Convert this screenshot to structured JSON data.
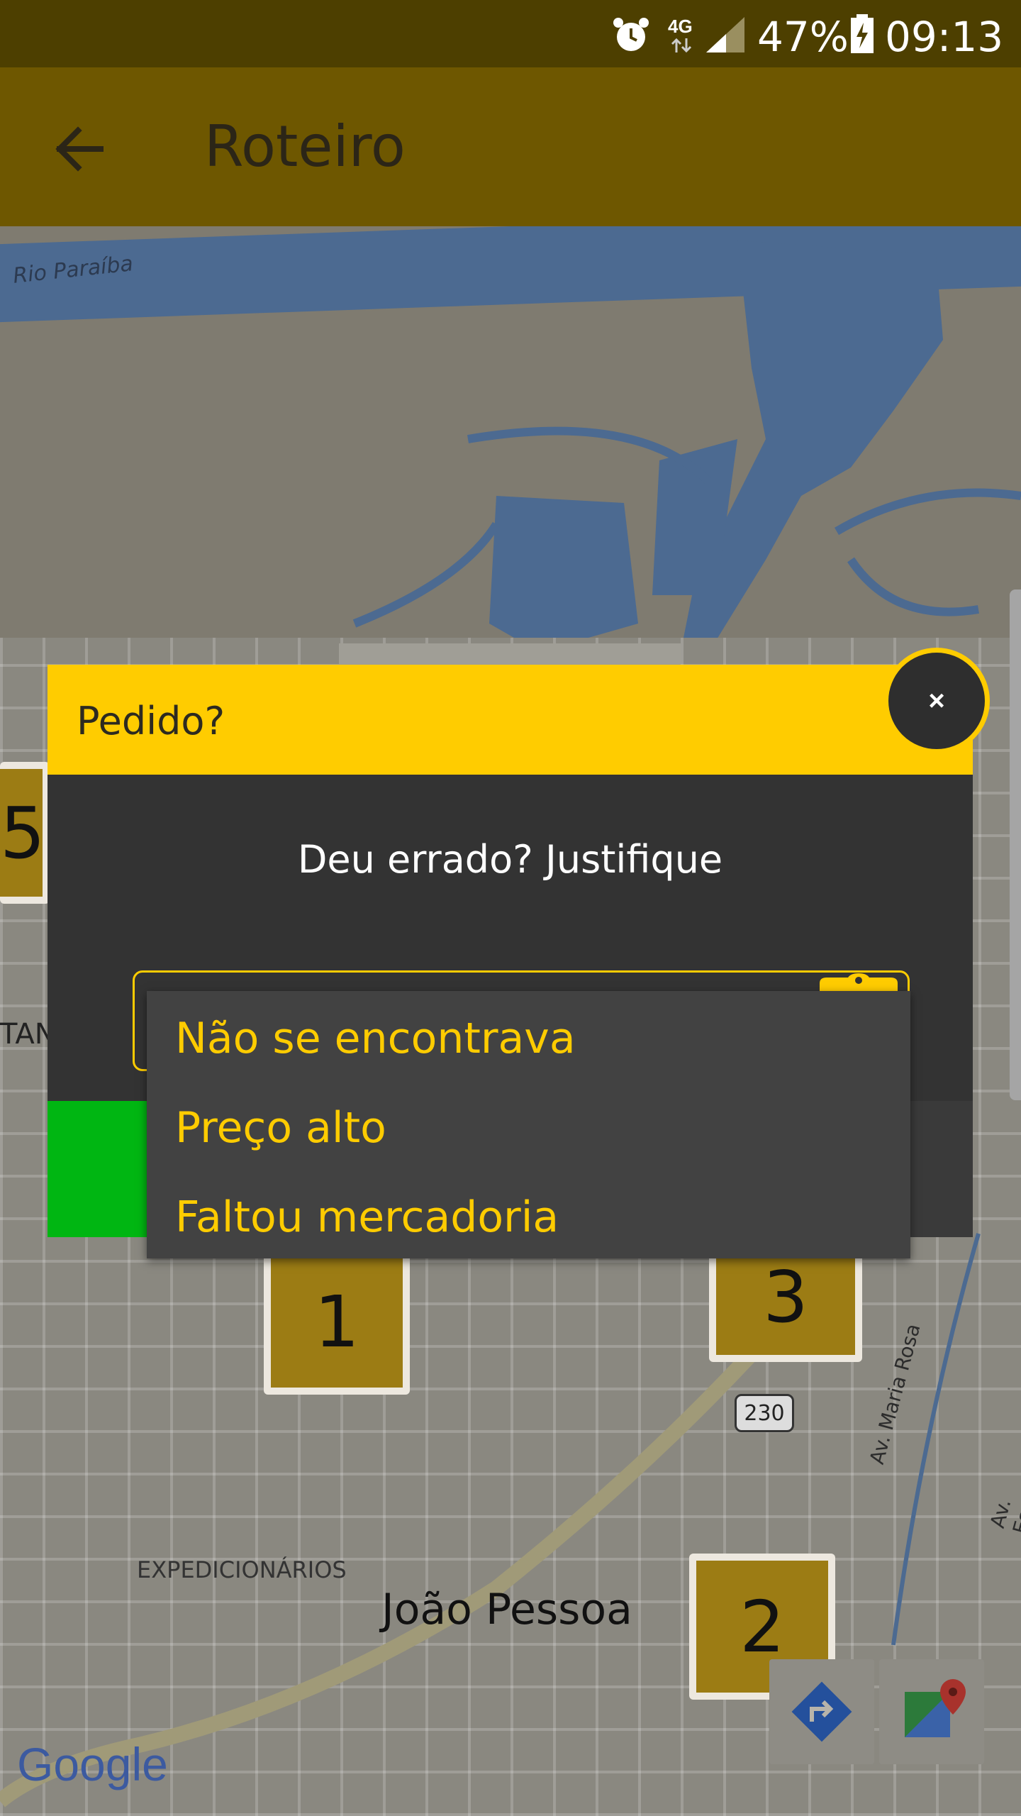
{
  "status_bar": {
    "signal_label": "4G",
    "battery": "47%",
    "time": "09:13"
  },
  "app_bar": {
    "title": "Roteiro"
  },
  "map": {
    "labels": {
      "river": "Rio Paraíba",
      "neighborhood": "EXPEDICIONÁRIOS",
      "city": "João Pessoa",
      "street_1": "Av. Maria Rosa",
      "street_2": "Av. Esperança",
      "partial_left": "TAN",
      "road_shield": "230",
      "google": "Google"
    },
    "markers": [
      "1",
      "2",
      "5",
      "3"
    ]
  },
  "dialog": {
    "title": "Pedido?",
    "close_label": "×",
    "prompt": "Deu errado? Justifique",
    "options": [
      "Não se encontrava",
      "Preço alto",
      "Faltou mercadoria"
    ]
  },
  "colors": {
    "accent": "#ffcc00",
    "green": "#00b612",
    "dialog_body": "#333333",
    "dropdown": "#424242"
  }
}
